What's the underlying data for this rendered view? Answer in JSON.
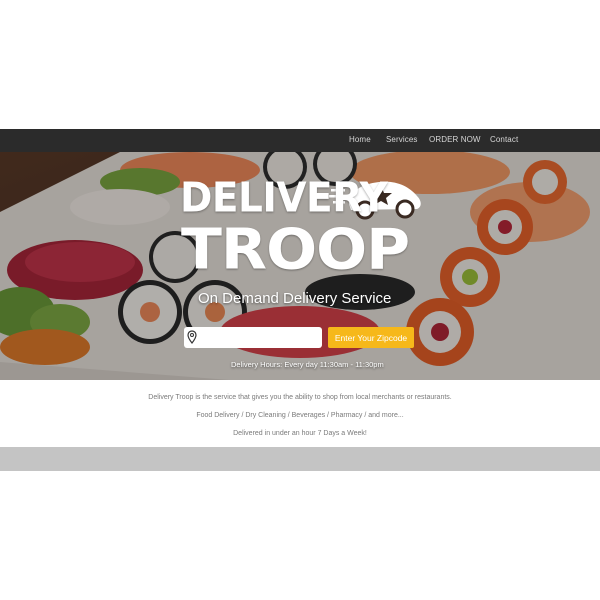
{
  "nav": {
    "items": [
      {
        "label": "Home"
      },
      {
        "label": "Services"
      },
      {
        "label": "ORDER NOW"
      },
      {
        "label": "Contact"
      }
    ]
  },
  "hero": {
    "logo_line1": "DELIVERY",
    "logo_line2": "TROOP",
    "tagline": "On Demand Delivery Service",
    "zip_input": {
      "value": "",
      "placeholder": ""
    },
    "zip_button_label": "Enter Your Zipcode",
    "hours": "Delivery Hours: Every day 11:30am - 11:30pm"
  },
  "info": {
    "line1": "Delivery Troop is the service that gives you the ability to shop from local merchants or restaurants.",
    "line2": "Food Delivery / Dry Cleaning / Beverages / Pharmacy / and more...",
    "line3": "Delivered in under an hour 7 Days a Week!"
  },
  "colors": {
    "nav_bg": "#2b2b2b",
    "accent_button": "#f6b81a",
    "footer_band": "#c4c4c4"
  },
  "icons": [
    "map-pin-icon",
    "delivery-car-icon"
  ]
}
